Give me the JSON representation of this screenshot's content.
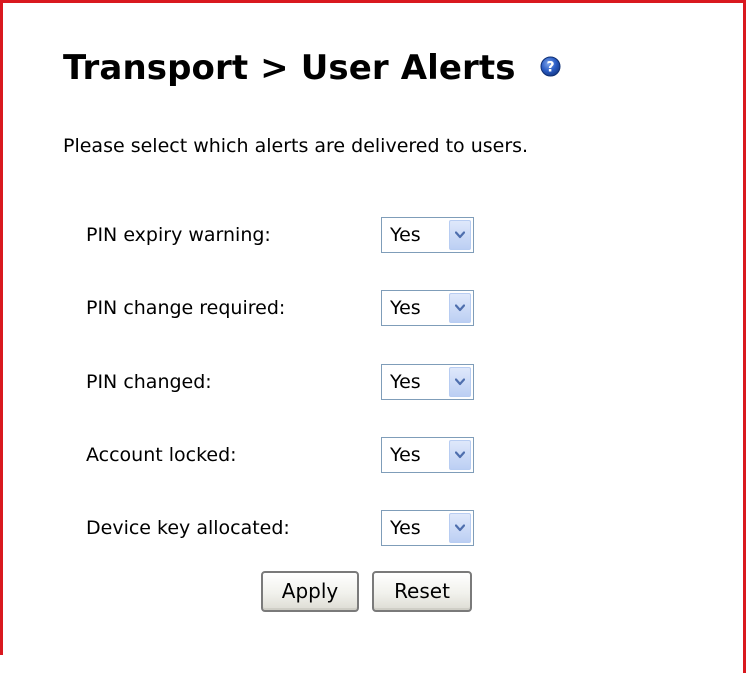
{
  "header": {
    "title": "Transport > User Alerts",
    "help_icon": "help-icon"
  },
  "intro_text": "Please select which alerts are delivered to users.",
  "alerts": [
    {
      "label": "PIN expiry warning:",
      "value": "Yes"
    },
    {
      "label": "PIN change required:",
      "value": "Yes"
    },
    {
      "label": "PIN changed:",
      "value": "Yes"
    },
    {
      "label": "Account locked:",
      "value": "Yes"
    },
    {
      "label": "Device key allocated:",
      "value": "Yes"
    }
  ],
  "buttons": {
    "apply_label": "Apply",
    "reset_label": "Reset"
  },
  "colors": {
    "frame_border": "#d9181f",
    "help_icon": "#1f4fb0",
    "select_arrow": "#4f6fae"
  }
}
